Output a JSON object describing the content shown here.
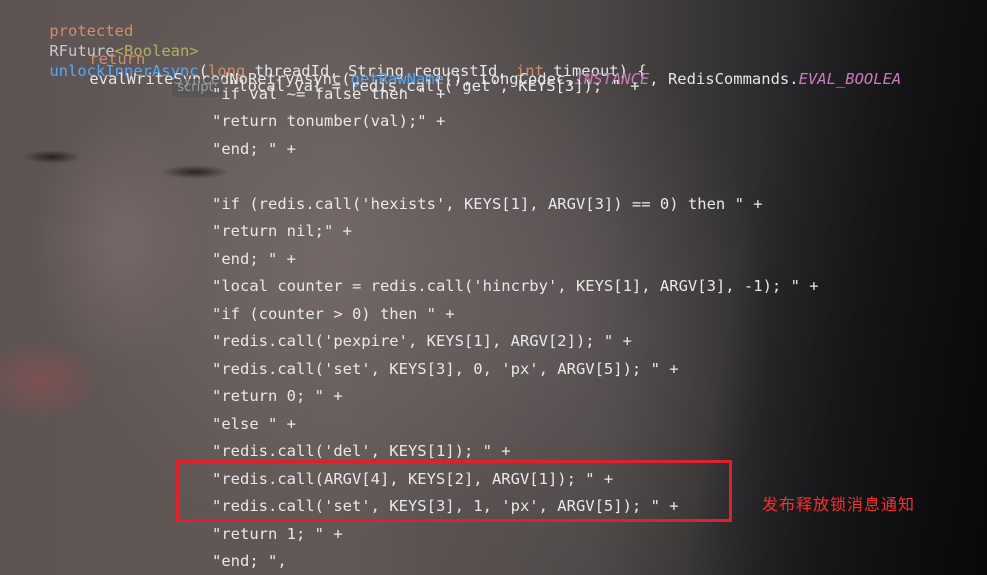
{
  "header": {
    "modifier": "protected",
    "return_type": "RFuture",
    "generic": "<Boolean>",
    "method_name": "unlockInnerAsync",
    "params_open": "(",
    "p1_type": "long",
    "p1_name": " threadId, ",
    "p2_type": "String",
    "p2_name": " requestId, ",
    "p3_type": "int",
    "p3_name": " timeout) {"
  },
  "call_line": {
    "keyword": "return",
    "method": "evalWriteSyncedNoRetryAsync",
    "args_a": "(",
    "getter": "getRawName",
    "args_b": "(), LongCodec.",
    "instance": "INSTANCE",
    "args_c": ", RedisCommands.",
    "eval": "EVAL_BOOLEA"
  },
  "param_hint": "script:",
  "script_lines": [
    "\"local val = redis.call('get', KEYS[3]); \" +",
    "\"if val ~= false then \" +",
    "\"return tonumber(val);\" +",
    "\"end; \" +",
    "",
    "\"if (redis.call('hexists', KEYS[1], ARGV[3]) == 0) then \" +",
    "\"return nil;\" +",
    "\"end; \" +",
    "\"local counter = redis.call('hincrby', KEYS[1], ARGV[3], -1); \" +",
    "\"if (counter > 0) then \" +",
    "\"redis.call('pexpire', KEYS[1], ARGV[2]); \" +",
    "\"redis.call('set', KEYS[3], 0, 'px', ARGV[5]); \" +",
    "\"return 0; \" +",
    "\"else \" +",
    "\"redis.call('del', KEYS[1]); \" +",
    "\"redis.call(ARGV[4], KEYS[2], ARGV[1]); \" +",
    "\"redis.call('set', KEYS[3], 1, 'px', ARGV[5]); \" +",
    "\"return 1; \" +",
    "\"end; \","
  ],
  "annotation_text": "发布释放锁消息通知",
  "colors": {
    "keyword": "#cf8e6d",
    "method": "#56a8f5",
    "highlight_box": "#e0202a",
    "annotation": "#ff2b2b"
  }
}
